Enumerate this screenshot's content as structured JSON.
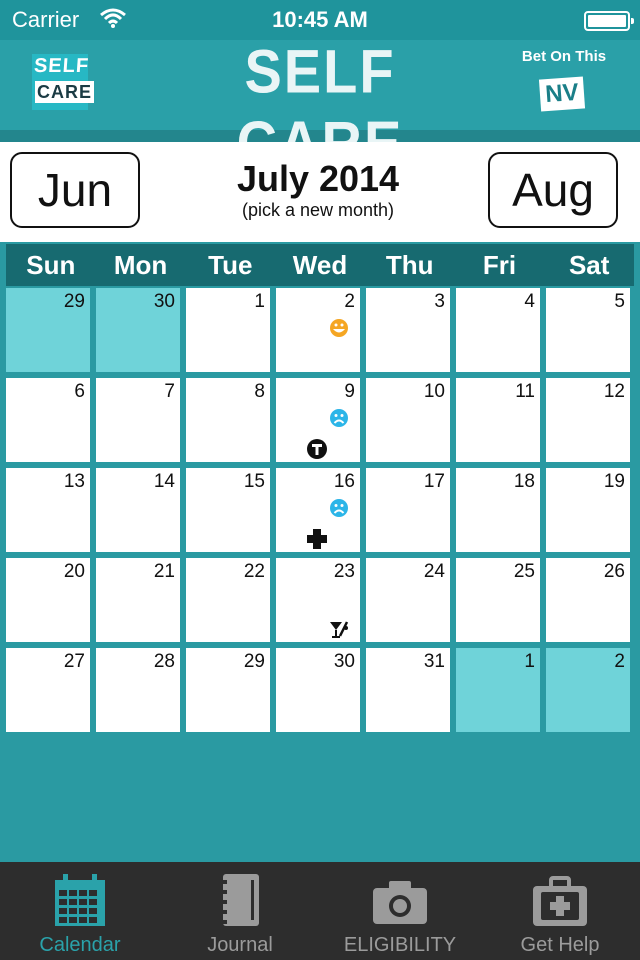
{
  "status_bar": {
    "carrier": "Carrier",
    "time": "10:45 AM"
  },
  "header": {
    "logo_line1": "SELF",
    "logo_line2": "CARE",
    "title": "SELF CARE",
    "sponsor_text": "Bet On This",
    "sponsor_badge": "NV"
  },
  "month_nav": {
    "prev_label": "Jun",
    "next_label": "Aug",
    "title": "July 2014",
    "subtitle": "(pick a new month)"
  },
  "weekdays": [
    "Sun",
    "Mon",
    "Tue",
    "Wed",
    "Thu",
    "Fri",
    "Sat"
  ],
  "days": [
    {
      "day": "29",
      "outside": true
    },
    {
      "day": "30",
      "outside": true
    },
    {
      "day": "1"
    },
    {
      "day": "2",
      "mood": "happy-face-icon"
    },
    {
      "day": "3"
    },
    {
      "day": "4"
    },
    {
      "day": "5"
    },
    {
      "day": "6"
    },
    {
      "day": "7"
    },
    {
      "day": "8"
    },
    {
      "day": "9",
      "mood": "sad-face-icon",
      "extra": "therapy-t-icon"
    },
    {
      "day": "10"
    },
    {
      "day": "11"
    },
    {
      "day": "12"
    },
    {
      "day": "13"
    },
    {
      "day": "14"
    },
    {
      "day": "15"
    },
    {
      "day": "16",
      "mood": "sad-face-icon",
      "extra": "medical-cross-icon"
    },
    {
      "day": "17"
    },
    {
      "day": "18"
    },
    {
      "day": "19"
    },
    {
      "day": "20"
    },
    {
      "day": "21"
    },
    {
      "day": "22"
    },
    {
      "day": "23",
      "extra": "cocktail-icon"
    },
    {
      "day": "24"
    },
    {
      "day": "25"
    },
    {
      "day": "26"
    },
    {
      "day": "27"
    },
    {
      "day": "28"
    },
    {
      "day": "29"
    },
    {
      "day": "30"
    },
    {
      "day": "31"
    },
    {
      "day": "1",
      "outside": true
    },
    {
      "day": "2",
      "outside": true
    }
  ],
  "tabs": [
    {
      "label": "Calendar",
      "icon": "calendar-icon",
      "active": true
    },
    {
      "label": "Journal",
      "icon": "journal-icon"
    },
    {
      "label": "ELIGIBILITY",
      "icon": "camera-icon"
    },
    {
      "label": "Get Help",
      "icon": "first-aid-kit-icon"
    }
  ],
  "colors": {
    "background": "#2a9aa2",
    "header": "#2aa0a8",
    "weekday_bar": "#176a70",
    "outside_day": "#6fd3d9",
    "tab_active": "#2aa2aa",
    "happy": "#f5a623",
    "sad": "#2bb5e8"
  }
}
